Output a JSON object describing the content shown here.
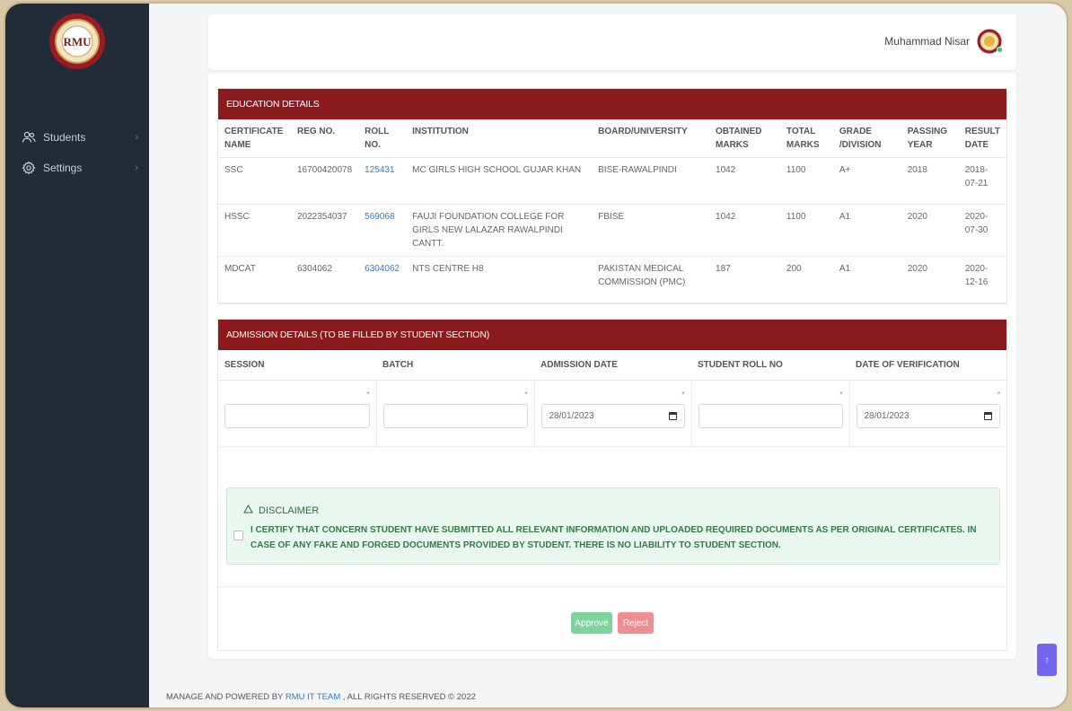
{
  "sidebar": {
    "logo_text": "RMU",
    "items": [
      {
        "label": "Students",
        "icon": "users-icon"
      },
      {
        "label": "Settings",
        "icon": "gear-icon"
      }
    ]
  },
  "header": {
    "user_name": "Muhammad Nisar"
  },
  "education": {
    "title": "EDUCATION DETAILS",
    "columns": [
      "CERTIFICATE NAME",
      "REG NO.",
      "ROLL NO.",
      "INSTITUTION",
      "BOARD/UNIVERSITY",
      "OBTAINED MARKS",
      "TOTAL MARKS",
      "GRADE /DIVISION",
      "PASSING YEAR",
      "RESULT DATE"
    ],
    "rows": [
      {
        "certificate": "SSC",
        "reg_no": "16700420078",
        "roll_no": "125431",
        "institution": "MC GIRLS HIGH SCHOOL GUJAR KHAN",
        "board": "BISE-RAWALPINDI",
        "obtained": "1042",
        "total": "1100",
        "grade": "A+",
        "year": "2018",
        "result_date": "2018-07-21"
      },
      {
        "certificate": "HSSC",
        "reg_no": "2022354037",
        "roll_no": "569068",
        "institution": "FAUJI FOUNDATION COLLEGE FOR GIRLS NEW LALAZAR RAWALPINDI CANTT.",
        "board": "FBISE",
        "obtained": "1042",
        "total": "1100",
        "grade": "A1",
        "year": "2020",
        "result_date": "2020-07-30"
      },
      {
        "certificate": "MDCAT",
        "reg_no": "6304062",
        "roll_no": "6304062",
        "institution": "NTS CENTRE H8",
        "board": "PAKISTAN MEDICAL COMMISSION (PMC)",
        "obtained": "187",
        "total": "200",
        "grade": "A1",
        "year": "2020",
        "result_date": "2020-12-16"
      }
    ]
  },
  "admission": {
    "title": "ADMISSION DETAILS (TO BE FILLED BY STUDENT SECTION)",
    "columns": [
      "SESSION",
      "BATCH",
      "ADMISSION DATE",
      "STUDENT ROLL NO",
      "DATE OF VERIFICATION"
    ],
    "fields": {
      "session": "",
      "batch": "",
      "admission_date": "28/01/2023",
      "student_roll_no": "",
      "date_of_verification": "28/01/2023"
    },
    "required_mark": "*"
  },
  "disclaimer": {
    "title": "DISCLAIMER",
    "text": "I CERTIFY THAT CONCERN STUDENT HAVE SUBMITTED ALL RELEVANT INFORMATION AND UPLOADED REQUIRED DOCUMENTS AS PER ORIGINAL CERTIFICATES. IN CASE OF ANY FAKE AND FORGED DOCUMENTS PROVIDED BY STUDENT. THERE IS NO LIABILITY TO STUDENT SECTION."
  },
  "actions": {
    "approve": "Approve",
    "reject": "Reject"
  },
  "footer": {
    "prefix": "MANAGE AND POWERED BY",
    "link": "RMU IT TEAM",
    "suffix": ", ALL RIGHTS RESERVED © 2022"
  },
  "scroll_top_icon": "arrow-up-icon",
  "colors": {
    "sidebar_bg": "#222b38",
    "panel_header": "#8b1a1f",
    "approve": "#7fd49d",
    "reject": "#ef8e8e",
    "link": "#2d7cc1",
    "scroll_top": "#7367f0"
  }
}
